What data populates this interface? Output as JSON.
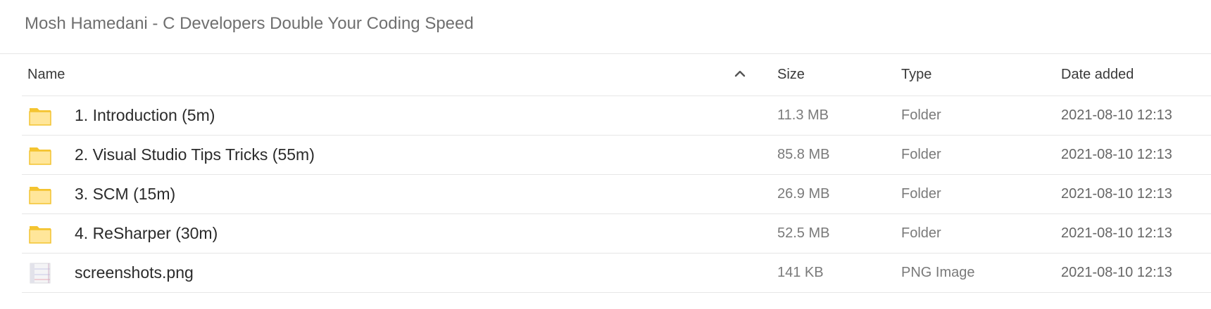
{
  "header": {
    "title": "Mosh Hamedani - C Developers Double Your Coding Speed"
  },
  "columns": {
    "name": "Name",
    "size": "Size",
    "type": "Type",
    "date": "Date added"
  },
  "sort": {
    "icon": "chevron-up-icon"
  },
  "colors": {
    "folder_body": "#FFE69A",
    "folder_edge": "#F4C430",
    "divider": "#e6e6e6"
  },
  "rows": [
    {
      "icon": "folder-icon",
      "name": "1. Introduction (5m)",
      "size": "11.3 MB",
      "type": "Folder",
      "date": "2021-08-10 12:13"
    },
    {
      "icon": "folder-icon",
      "name": "2. Visual Studio Tips Tricks (55m)",
      "size": "85.8 MB",
      "type": "Folder",
      "date": "2021-08-10 12:13"
    },
    {
      "icon": "folder-icon",
      "name": "3. SCM (15m)",
      "size": "26.9 MB",
      "type": "Folder",
      "date": "2021-08-10 12:13"
    },
    {
      "icon": "folder-icon",
      "name": "4. ReSharper (30m)",
      "size": "52.5 MB",
      "type": "Folder",
      "date": "2021-08-10 12:13"
    },
    {
      "icon": "image-file-icon",
      "name": "screenshots.png",
      "size": "141 KB",
      "type": "PNG Image",
      "date": "2021-08-10 12:13"
    }
  ]
}
